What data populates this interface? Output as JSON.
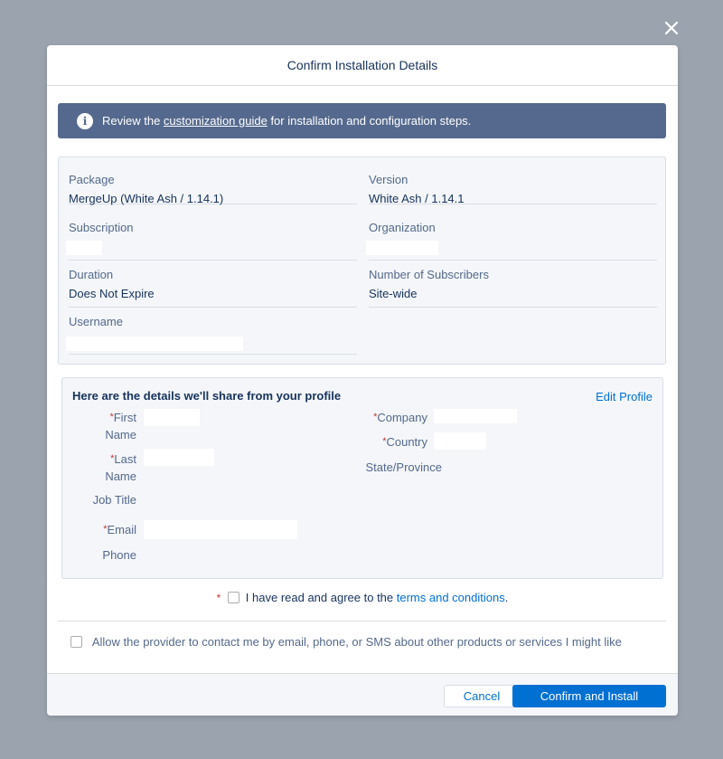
{
  "modal": {
    "title": "Confirm Installation Details",
    "close_icon": "close-icon"
  },
  "banner": {
    "icon": "info-icon",
    "icon_glyph": "i",
    "text_before": "Review the ",
    "link_text": "customization guide",
    "text_after": " for installation and configuration steps."
  },
  "package": {
    "package_label": "Package",
    "package_value": "MergeUp (White Ash / 1.14.1)",
    "version_label": "Version",
    "version_value": "White Ash / 1.14.1",
    "subscription_label": "Subscription",
    "organization_label": "Organization",
    "duration_label": "Duration",
    "duration_value": "Does Not Expire",
    "subscribers_label": "Number of Subscribers",
    "subscribers_value": "Site-wide",
    "username_label": "Username"
  },
  "profile": {
    "title": "Here are the details we'll share from your profile",
    "edit_link": "Edit Profile",
    "required_mark": "*",
    "first_name_label_1": "First",
    "first_name_label_2": "Name",
    "last_name_label_1": "Last",
    "last_name_label_2": "Name",
    "job_title_label": "Job Title",
    "email_label": "Email",
    "phone_label": "Phone",
    "company_label": "Company",
    "country_label": "Country",
    "state_label": "State/Province"
  },
  "agreement": {
    "required_mark": "*",
    "text": "I have read and agree to the ",
    "link_text": "terms and conditions",
    "suffix": "."
  },
  "contact": {
    "text": "Allow the provider to contact me by email, phone, or SMS about other products or services I might like"
  },
  "footer": {
    "cancel_label": "Cancel",
    "confirm_label": "Confirm and Install"
  },
  "colors": {
    "overlay": "#9ba3ae",
    "banner": "#54698d",
    "primary": "#0070d2",
    "text": "#16325c",
    "required": "#c23934"
  }
}
